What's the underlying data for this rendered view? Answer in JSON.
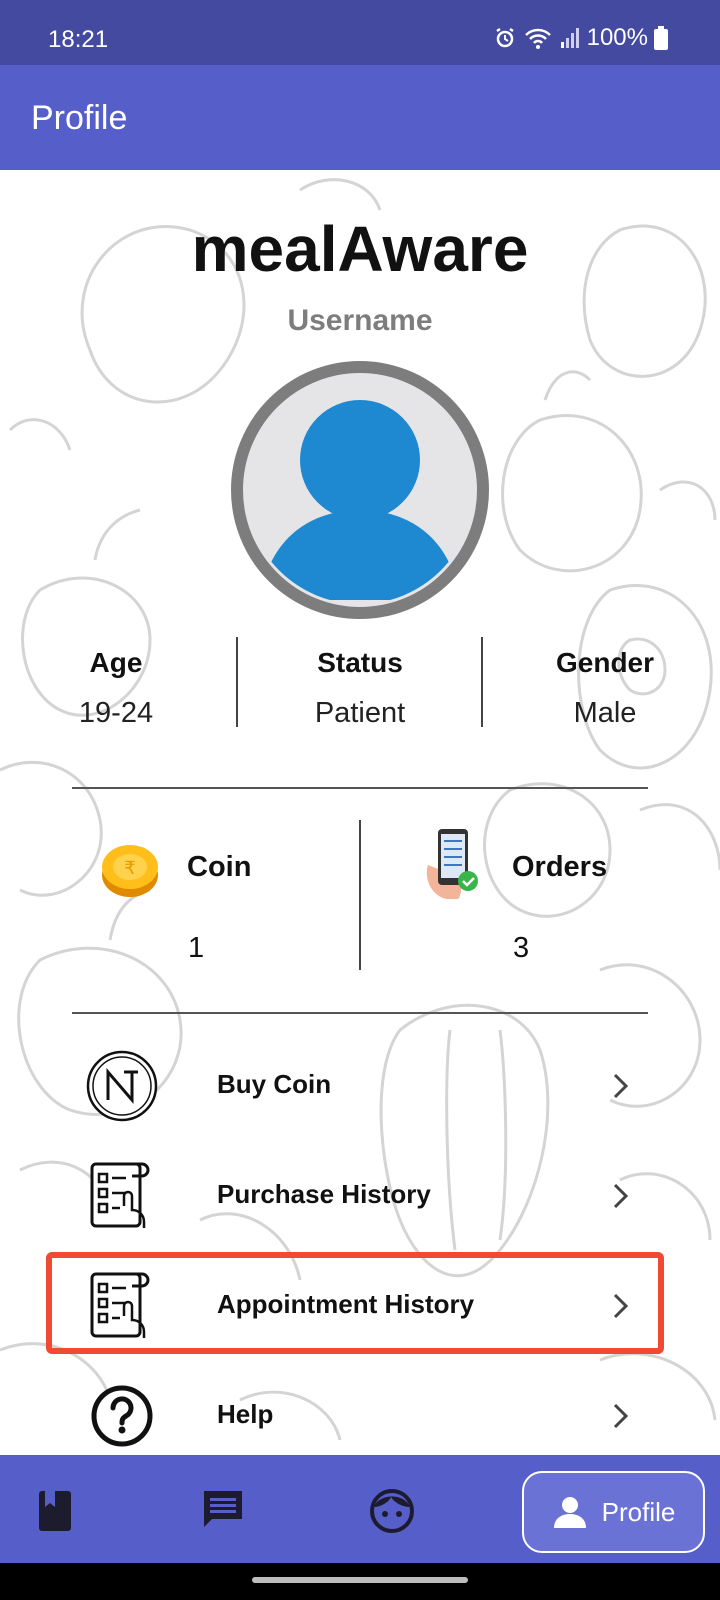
{
  "status_bar": {
    "time": "18:21",
    "battery": "100%"
  },
  "app_bar": {
    "title": "Profile"
  },
  "profile": {
    "app_name": "mealAware",
    "username": "Username",
    "stats": [
      {
        "label": "Age",
        "value": "19-24"
      },
      {
        "label": "Status",
        "value": "Patient"
      },
      {
        "label": "Gender",
        "value": "Male"
      }
    ],
    "coin": {
      "label": "Coin",
      "value": "1"
    },
    "orders": {
      "label": "Orders",
      "value": "3"
    }
  },
  "menu": {
    "items": [
      {
        "label": "Buy Coin",
        "icon": "brand-n-icon"
      },
      {
        "label": "Purchase History",
        "icon": "checklist-icon"
      },
      {
        "label": "Appointment History",
        "icon": "checklist-icon"
      },
      {
        "label": "Help",
        "icon": "help-icon"
      }
    ]
  },
  "bottom_nav": {
    "profile_label": "Profile"
  },
  "colors": {
    "primary": "#565ec9",
    "status_bar": "#434a9f",
    "highlight": "#f04a35",
    "avatar_blue": "#1e88d1"
  }
}
